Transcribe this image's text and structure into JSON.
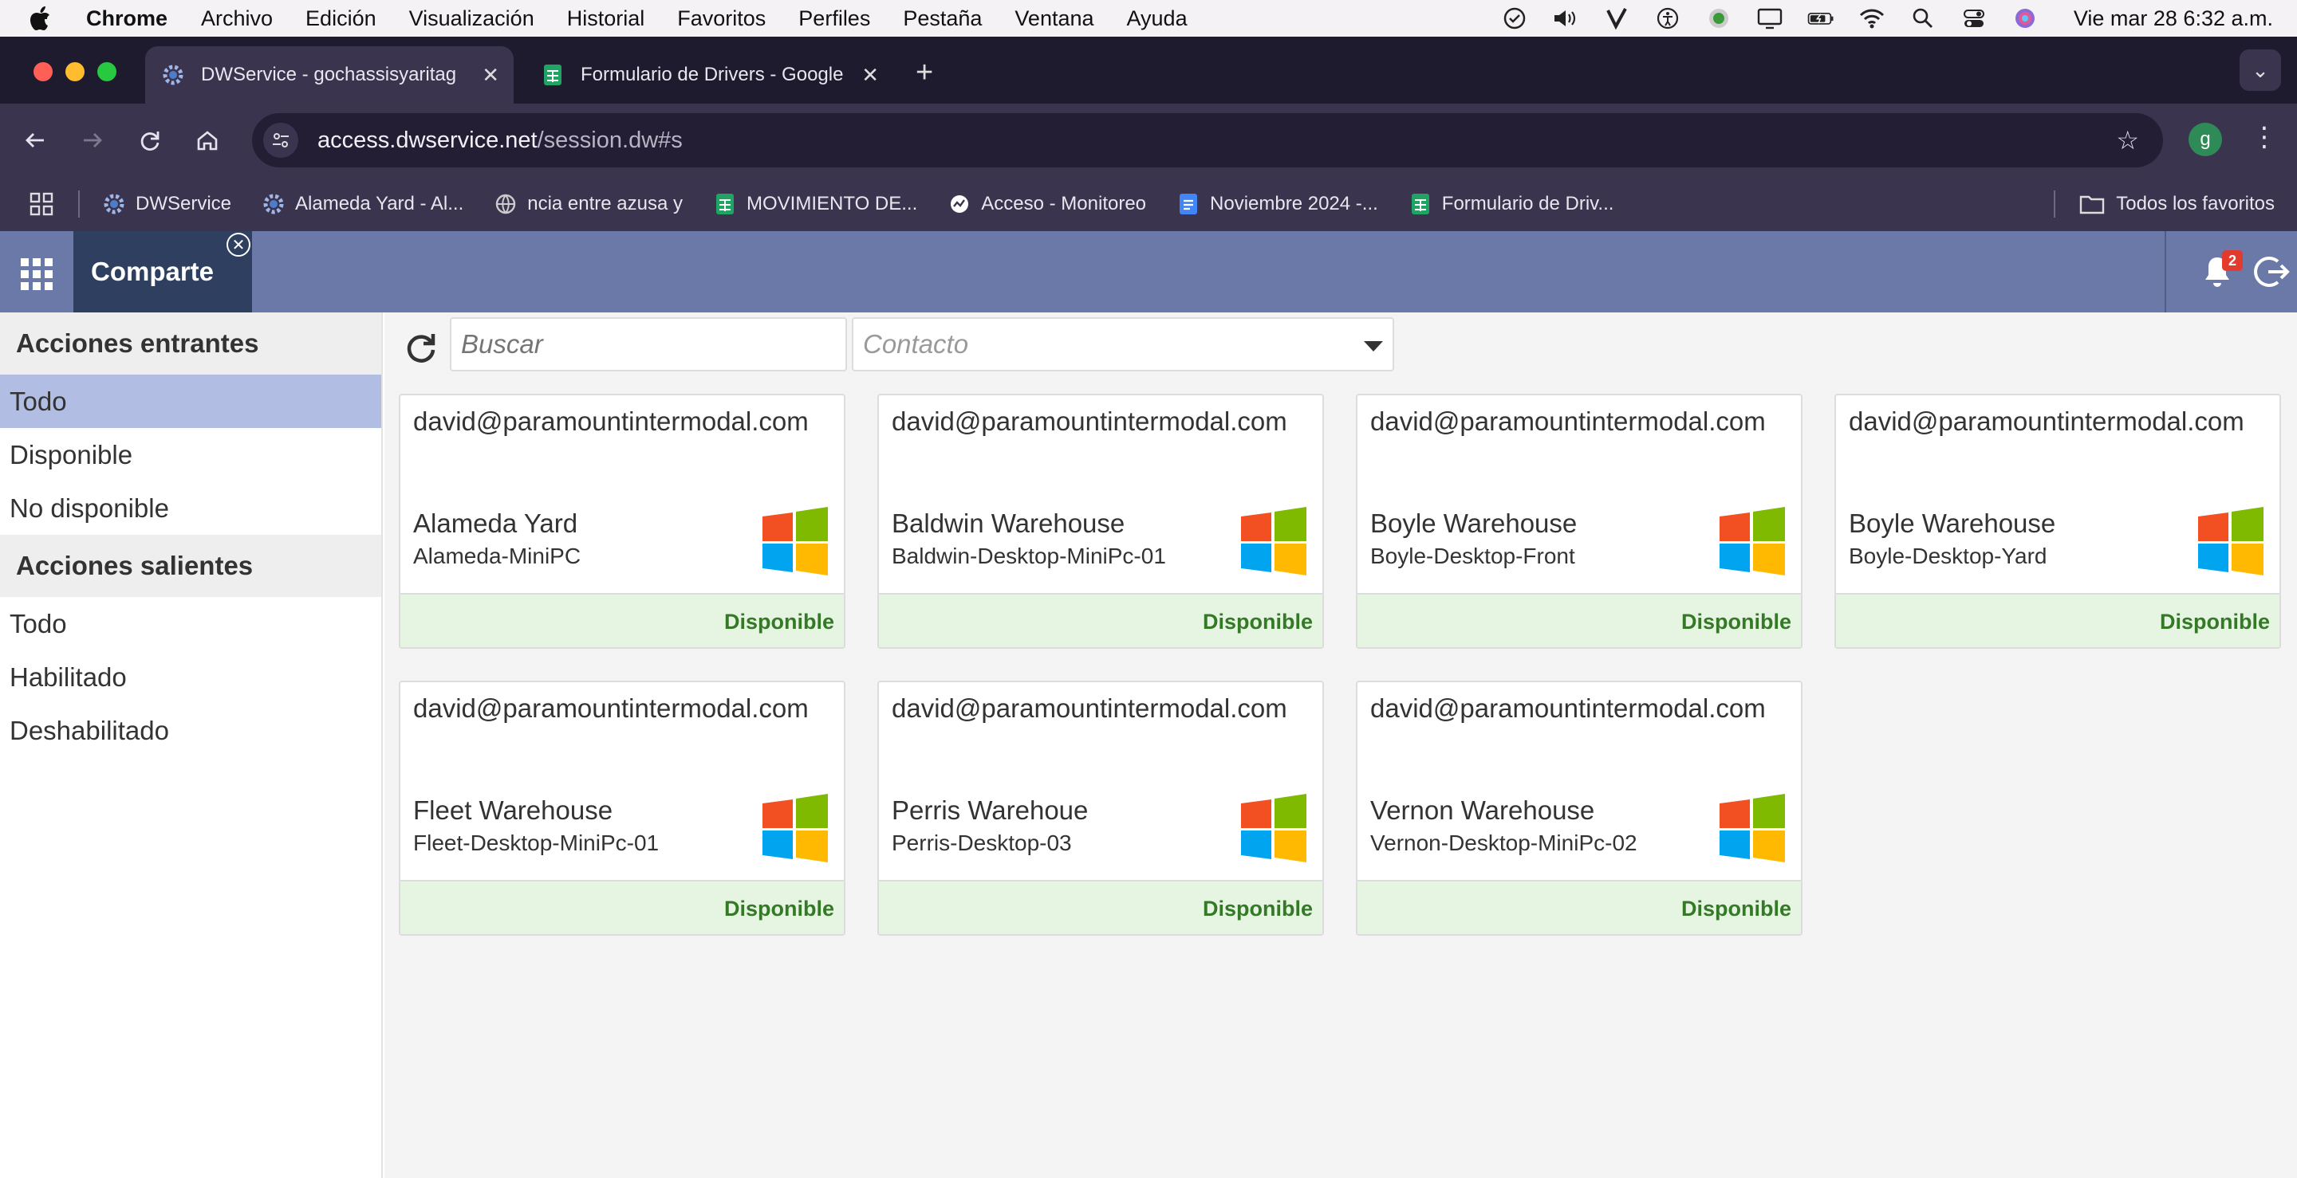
{
  "menubar": {
    "app_name": "Chrome",
    "items": [
      "Archivo",
      "Edición",
      "Visualización",
      "Historial",
      "Favoritos",
      "Perfiles",
      "Pestaña",
      "Ventana",
      "Ayuda"
    ],
    "clock": "Vie mar 28  6:32 a.m."
  },
  "tabs": [
    {
      "title": "DWService - gochassisyaritag",
      "active": true
    },
    {
      "title": "Formulario de Drivers - Google",
      "active": false
    }
  ],
  "toolbar": {
    "url_host": "access.dwservice.net",
    "url_path": "/session.dw#s",
    "profile_initial": "g"
  },
  "bookmarks": {
    "items": [
      {
        "label": "DWService",
        "icon": "dwservice-icon"
      },
      {
        "label": "Alameda Yard - Al...",
        "icon": "dwservice-icon"
      },
      {
        "label": "ncia entre azusa y",
        "icon": "globe-icon"
      },
      {
        "label": "MOVIMIENTO DE...",
        "icon": "sheets-icon"
      },
      {
        "label": "Acceso - Monitoreo",
        "icon": "monitor-icon"
      },
      {
        "label": "Noviembre 2024 -...",
        "icon": "docs-icon"
      },
      {
        "label": "Formulario de Driv...",
        "icon": "sheets-icon"
      }
    ],
    "all_label": "Todos los favoritos"
  },
  "header": {
    "tab_label": "Comparte",
    "notification_count": "2"
  },
  "sidebar": {
    "incoming_title": "Acciones entrantes",
    "incoming": [
      "Todo",
      "Disponible",
      "No disponible"
    ],
    "outgoing_title": "Acciones salientes",
    "outgoing": [
      "Todo",
      "Habilitado",
      "Deshabilitado"
    ]
  },
  "filters": {
    "search_placeholder": "Buscar",
    "contact_placeholder": "Contacto"
  },
  "cards": [
    {
      "owner": "david@paramountintermodal.com",
      "name": "Alameda Yard",
      "host": "Alameda-MiniPC",
      "status": "Disponible"
    },
    {
      "owner": "david@paramountintermodal.com",
      "name": "Baldwin Warehouse",
      "host": "Baldwin-Desktop-MiniPc-01",
      "status": "Disponible"
    },
    {
      "owner": "david@paramountintermodal.com",
      "name": "Boyle Warehouse",
      "host": "Boyle-Desktop-Front",
      "status": "Disponible"
    },
    {
      "owner": "david@paramountintermodal.com",
      "name": "Boyle Warehouse",
      "host": "Boyle-Desktop-Yard",
      "status": "Disponible"
    },
    {
      "owner": "david@paramountintermodal.com",
      "name": "Fleet Warehouse",
      "host": "Fleet-Desktop-MiniPc-01",
      "status": "Disponible"
    },
    {
      "owner": "david@paramountintermodal.com",
      "name": "Perris Warehoue",
      "host": "Perris-Desktop-03",
      "status": "Disponible"
    },
    {
      "owner": "david@paramountintermodal.com",
      "name": "Vernon Warehouse",
      "host": "Vernon-Desktop-MiniPc-02",
      "status": "Disponible"
    }
  ],
  "colors": {
    "header": "#6a79a8",
    "selected_filter": "#b1bde2",
    "status_text": "#347a26",
    "status_bg": "#e6f4e2"
  }
}
